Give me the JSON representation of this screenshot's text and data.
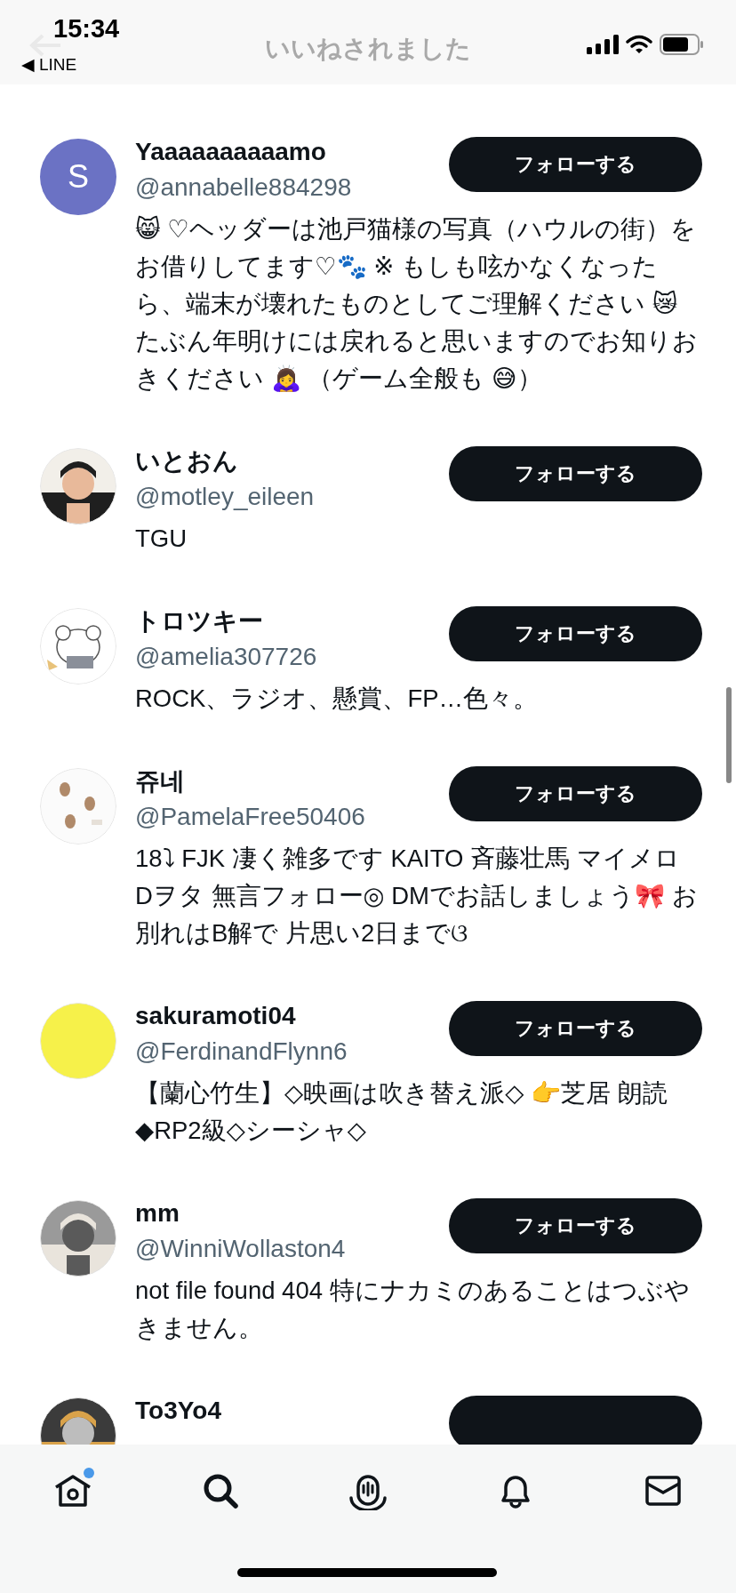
{
  "status_bar": {
    "time": "15:34",
    "back_app": "◀ LINE"
  },
  "header": {
    "title": "いいねされました"
  },
  "users": [
    {
      "avatar": {
        "kind": "letter",
        "letter": "S",
        "color": "#6b72c4"
      },
      "name": "Yaaaaaaaaaamo",
      "handle": "@annabelle884298",
      "follow_label": "フォローする",
      "bio": "😸 ♡ヘッダーは池戸猫様の写真（ハウルの街）をお借りしてます♡🐾 ※ もしも呟かなくなったら、端末が壊れたものとしてご理解ください 😿 たぶん年明けには戻れると思いますのでお知りおきください 🙇‍♀️ （ゲーム全般も 😅）"
    },
    {
      "name": "いとおん",
      "handle": "@motley_eileen",
      "follow_label": "フォローする",
      "bio": "TGU"
    },
    {
      "name": "トロツキー",
      "handle": "@amelia307726",
      "follow_label": "フォローする",
      "bio": "ROCK、ラジオ、懸賞、FP…色々。"
    },
    {
      "name": "쥬네",
      "handle": "@PamelaFree50406",
      "follow_label": "フォローする",
      "bio": "18⤵ FJK 凄く雑多です KAITO 斉藤壮馬 マイメロ Dヲタ 無言フォロー◎ DMでお話しましょう🎀 お別れはB解で 片思い2日までଓ"
    },
    {
      "name": "sakuramoti04",
      "handle": "@FerdinandFlynn6",
      "follow_label": "フォローする",
      "bio": "【蘭心竹生】◇映画は吹き替え派◇ 👉芝居 朗読 ◆RP2級◇シーシャ◇"
    },
    {
      "name": "mm",
      "handle": "@WinniWollaston4",
      "follow_label": "フォローする",
      "bio": "not file found 404 特にナカミのあることはつぶやきません。"
    },
    {
      "name": "To3Yo4"
    }
  ],
  "tabs": [
    {
      "kind": "home",
      "badge": true
    },
    {
      "kind": "search",
      "badge": false
    },
    {
      "kind": "spaces",
      "badge": false
    },
    {
      "kind": "notifications",
      "badge": false
    },
    {
      "kind": "messages",
      "badge": false
    }
  ]
}
